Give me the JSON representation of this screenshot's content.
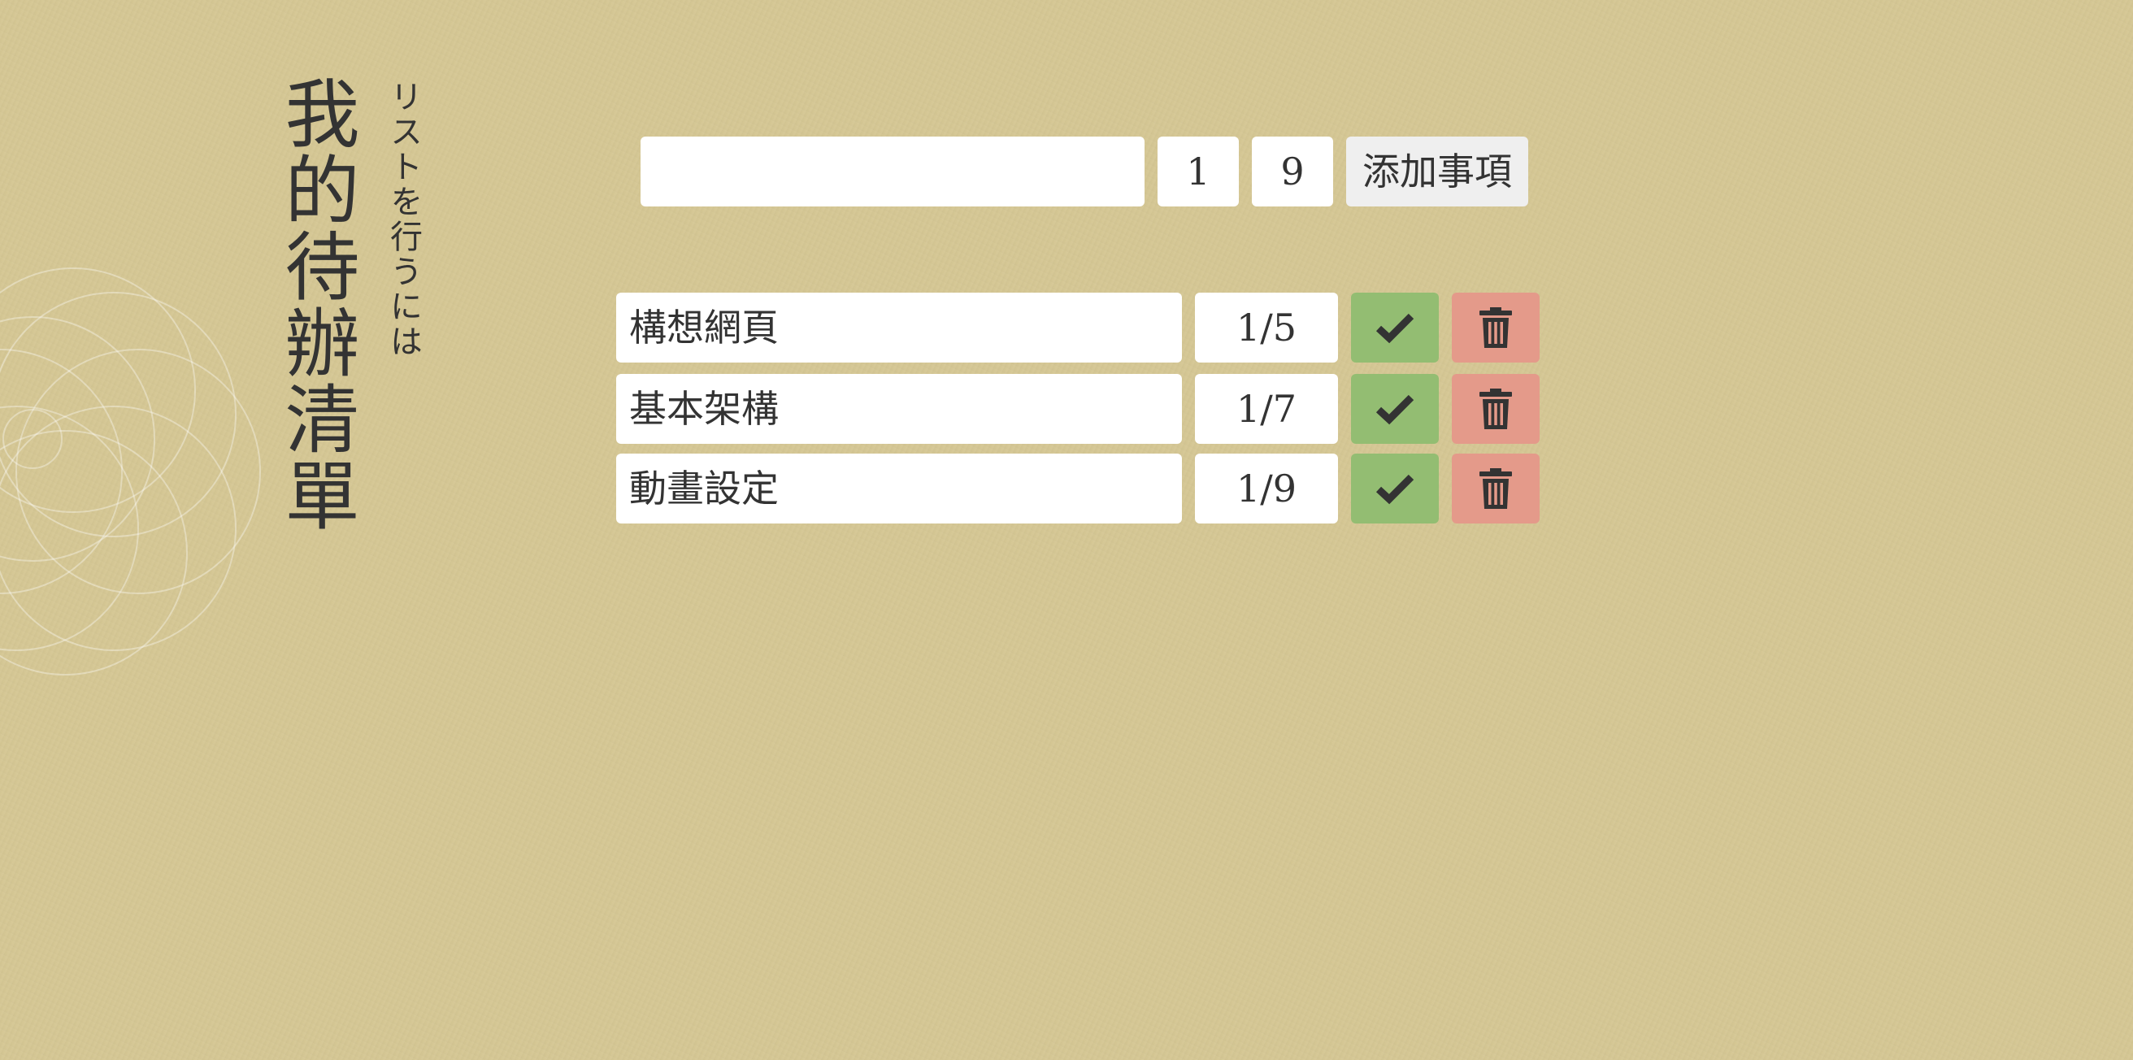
{
  "title": {
    "main": "我的待辦清單",
    "subtitle": "リストを行うには"
  },
  "form": {
    "task_input_value": "",
    "month_value": "1",
    "day_value": "9",
    "add_button_label": "添加事項"
  },
  "todos": [
    {
      "text": "構想網頁",
      "date": "1/5"
    },
    {
      "text": "基本架構",
      "date": "1/7"
    },
    {
      "text": "動畫設定",
      "date": "1/9"
    }
  ],
  "icons": {
    "done": "check-icon",
    "delete": "trash-icon"
  },
  "colors": {
    "background": "#d5c794",
    "text": "#333333",
    "done_button": "#93bd72",
    "delete_button": "#e49a8a",
    "add_button": "#efefef",
    "input_background": "#ffffff"
  }
}
